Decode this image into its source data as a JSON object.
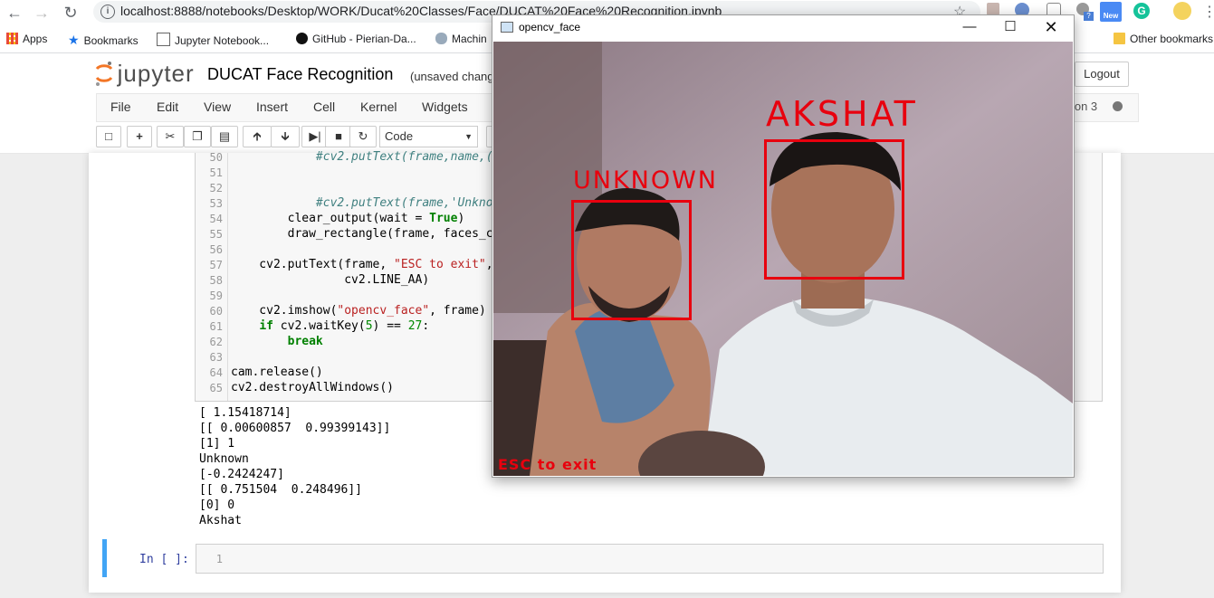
{
  "browser": {
    "url": "localhost:8888/notebooks/Desktop/WORK/Ducat%20Classes/Face/DUCAT%20Face%20Recognition.ipynb",
    "bookmarks": [
      "Apps",
      "Bookmarks",
      "Jupyter Notebook...",
      "GitHub - Pierian-Da...",
      "Machin",
      "Other bookmarks"
    ],
    "ext_badge": "New"
  },
  "jupyter": {
    "logo_text": "jupyter",
    "title": "DUCAT Face Recognition",
    "status": "(unsaved chang",
    "logout": "Logout",
    "menu": [
      "File",
      "Edit",
      "View",
      "Insert",
      "Cell",
      "Kernel",
      "Widgets"
    ],
    "kernel": "thon 3",
    "cell_type": "Code"
  },
  "code": {
    "line_numbers": [
      "50",
      "51",
      "52",
      "53",
      "54",
      "55",
      "56",
      "57",
      "58",
      "59",
      "60",
      "61",
      "62",
      "63",
      "64",
      "65"
    ],
    "l50": "            #cv2.putText(frame,name,(x",
    "l53": "            #cv2.putText(frame,'Unknown",
    "l54a": "        clear_output(wait = ",
    "l54b": "True",
    "l54c": ")",
    "l55": "        draw_rectangle(frame, faces_co",
    "l57a": "    cv2.putText(frame, ",
    "l57b": "\"ESC to exit\"",
    "l57c": ",",
    "l58": "                cv2.LINE_AA)",
    "l60a": "    cv2.imshow(",
    "l60b": "\"opencv_face\"",
    "l60c": ", frame) #",
    "l61a": "    ",
    "l61b": "if",
    "l61c": " cv2.waitKey(",
    "l61d": "5",
    "l61e": ") == ",
    "l61f": "27",
    "l61g": ":",
    "l62a": "        ",
    "l62b": "break",
    "l64": "cam.release()",
    "l65": "cv2.destroyAllWindows()"
  },
  "output": [
    "[ 1.15418714]",
    "[[ 0.00600857  0.99399143]]",
    "[1] 1",
    "Unknown",
    "[-0.2424247]",
    "[[ 0.751504  0.248496]]",
    "[0] 0",
    "Akshat"
  ],
  "new_cell": {
    "prompt": "In [ ]:",
    "line": "1"
  },
  "cv_window": {
    "title": "opencv_face",
    "labels": [
      "UNKNOWN",
      "AKSHAT"
    ],
    "footer": "ESC to exit"
  },
  "colors": {
    "box": "#e8000e",
    "accent": "#42a5f5"
  }
}
